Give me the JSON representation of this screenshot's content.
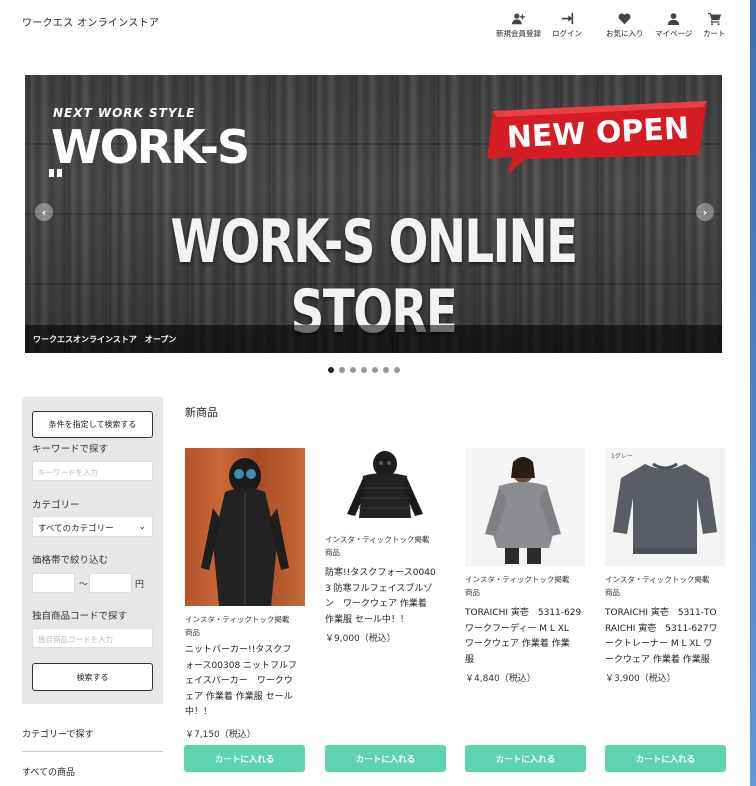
{
  "header": {
    "logo": "ワークエス オンラインストア",
    "nav": [
      {
        "label": "新規会員登録",
        "icon": "user-plus-icon"
      },
      {
        "label": "ログイン",
        "icon": "login-icon"
      },
      {
        "label": "お気に入り",
        "icon": "heart-icon"
      },
      {
        "label": "マイページ",
        "icon": "user-icon"
      },
      {
        "label": "カート",
        "icon": "cart-icon"
      }
    ]
  },
  "hero": {
    "next_work_style": "NEXT WORK STYLE",
    "brand": "WORK-S",
    "badge": "NEW OPEN",
    "headline": "WORK-S ONLINE STORE",
    "caption": "ワークエスオンラインストア　オープン",
    "prev": "‹",
    "next": "›",
    "slide_count": 7,
    "active_slide": 1
  },
  "sidebar": {
    "filter_button": "条件を指定して検索する",
    "keyword_label": "キーワードで探す",
    "keyword_placeholder": "キーワードを入力",
    "category_label": "カテゴリー",
    "category_selected": "すべてのカテゴリー",
    "price_label": "価格帯で絞り込む",
    "price_separator": "〜",
    "price_unit": "円",
    "code_label": "独自商品コードで探す",
    "code_placeholder": "独自商品コードを入力",
    "search_button": "検索する",
    "category_link": "カテゴリーで探す",
    "all_products_link": "すべての商品"
  },
  "main": {
    "section_title": "新商品",
    "products": [
      {
        "tag_line1": "インスタ・ティックトック掲載",
        "tag_line2": "商品",
        "name_lines": [
          "ニットパーカー!!タスクフ",
          "ォース00308 ニットフルフ",
          "ェイスパーカー　ワークウ",
          "ェア 作業着 作業服 セール",
          "中！！"
        ],
        "price": "￥7,150（税込）",
        "cart": "カートに入れる"
      },
      {
        "tag_line1": "インスタ・ティックトック掲載",
        "tag_line2": "商品",
        "name_lines": [
          "防寒!!タスクフォース0040",
          "3 防寒フルフェイスブルゾ",
          "ン　ワークウェア 作業着",
          "作業服 セール中！！"
        ],
        "price": "￥9,000（税込）",
        "cart": "カートに入れる"
      },
      {
        "tag_line1": "インスタ・ティックトック掲載",
        "tag_line2": "商品",
        "name_lines": [
          "TORAICHI 寅壱　5311-629",
          "ワークフーディー M L XL",
          "ワークウェア 作業着 作業",
          "服"
        ],
        "price": "￥4,840（税込）",
        "cart": "カートに入れる"
      },
      {
        "tag_line1": "インスタ・ティックトック掲載",
        "tag_line2": "商品",
        "name_lines": [
          "TORAICHI 寅壱　5311-TO",
          "RAICHI 寅壱　5311-627ワ",
          "ークトレーナー M L XL ワ",
          "ークウェア 作業着 作業服"
        ],
        "price": "￥3,900（税込）",
        "cart": "カートに入れる"
      }
    ],
    "product4_img_label": "1グレー"
  },
  "colors": {
    "accent": "#5ed3b0",
    "badge_red": "#d41c22",
    "sidebar_bg": "#e7e7e7"
  }
}
